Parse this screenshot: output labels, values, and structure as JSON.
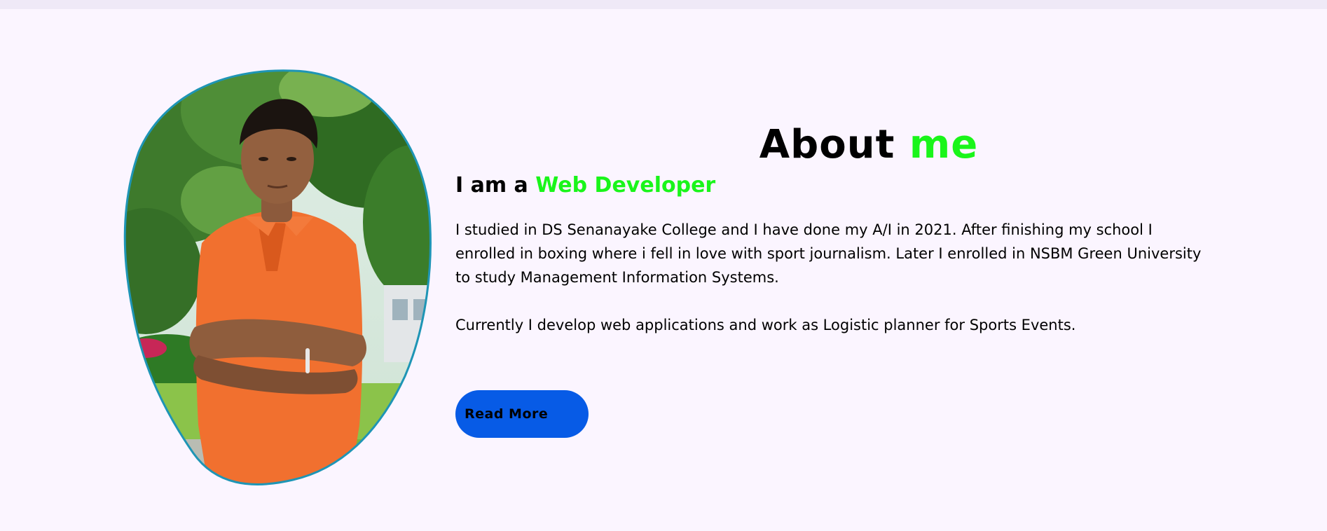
{
  "about": {
    "title_main": "About",
    "title_accent": "me",
    "subtitle_prefix": "I am a",
    "subtitle_role": "Web Developer",
    "paragraph_1": "I studied in DS Senanayake College and I have done my A/I in 2021. After finishing my school I enrolled in boxing where i fell in love with sport journalism. Later I enrolled in NSBM Green University to study Management Information Systems.",
    "paragraph_2": "Currently I develop web applications and work as Logistic planner for Sports Events.",
    "read_more_label": "Read More"
  },
  "colors": {
    "page_background": "#fbf5ff",
    "accent_green": "#1af51a",
    "button_blue": "#075be6",
    "photo_border": "#1e95b5"
  }
}
